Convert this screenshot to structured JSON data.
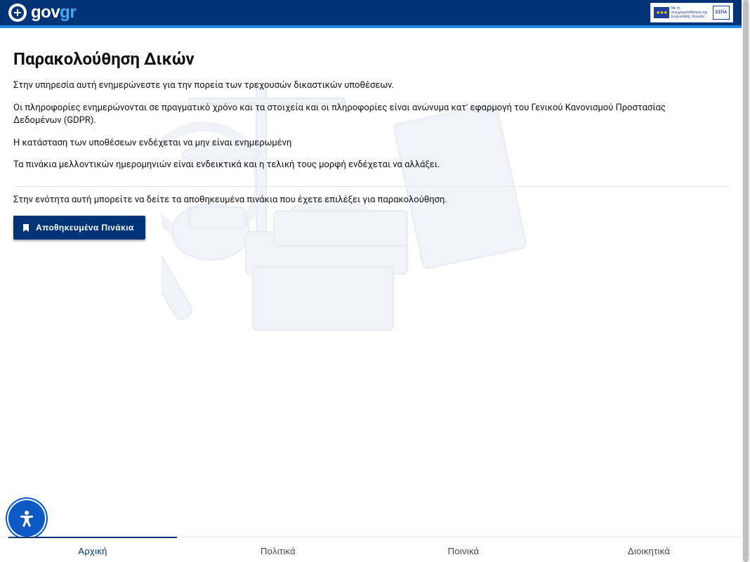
{
  "header": {
    "logo_main": "gov",
    "logo_accent": "gr",
    "espa_text": "Με τη συγχρηματοδότηση της Ευρωπαϊκής Ένωσης",
    "espa_logo": "ΕΣΠΑ"
  },
  "main": {
    "title": "Παρακολούθηση Δικών",
    "paragraphs": [
      "Στην υπηρεσία αυτή ενημερώνεστε για την πορεία των τρεχουσών δικαστικών υποθέσεων.",
      "Οι πληροφορίες ενημερώνονται σε πραγματικό χρόνο και τα στοιχεία και οι πληροφορίες είναι ανώνυμα κατ' εφαρμογή του Γενικού Κανονισμού Προστασίας Δεδομένων (GDPR).",
      "Η κατάσταση των υποθέσεων ενδέχεται να μην είναι ενημερωμένη",
      "Τα πινάκια μελλοντικών ημερομηνιών είναι ενδεικτικά και η τελική τους μορφή ενδέχεται να αλλάξει."
    ],
    "saved_intro": "Στην ενότητα αυτή μπορείτε να δείτε τα αποθηκευμένα πινάκια που έχετε επιλέξει για παρακολούθηση.",
    "saved_button_label": "Αποθηκευμένα Πινάκια"
  },
  "bottom_nav": {
    "tabs": [
      {
        "label": "Αρχική",
        "active": true
      },
      {
        "label": "Πολιτικά",
        "active": false
      },
      {
        "label": "Ποινικά",
        "active": false
      },
      {
        "label": "Διοικητικά",
        "active": false
      }
    ]
  },
  "colors": {
    "brand": "#003476",
    "accent": "#1b8ae0",
    "accessibility_button": "#0a59c4"
  },
  "icons": {
    "emblem": "greek-coat-of-arms-icon",
    "bookmark": "bookmark-icon",
    "accessibility": "accessibility-person-icon"
  }
}
